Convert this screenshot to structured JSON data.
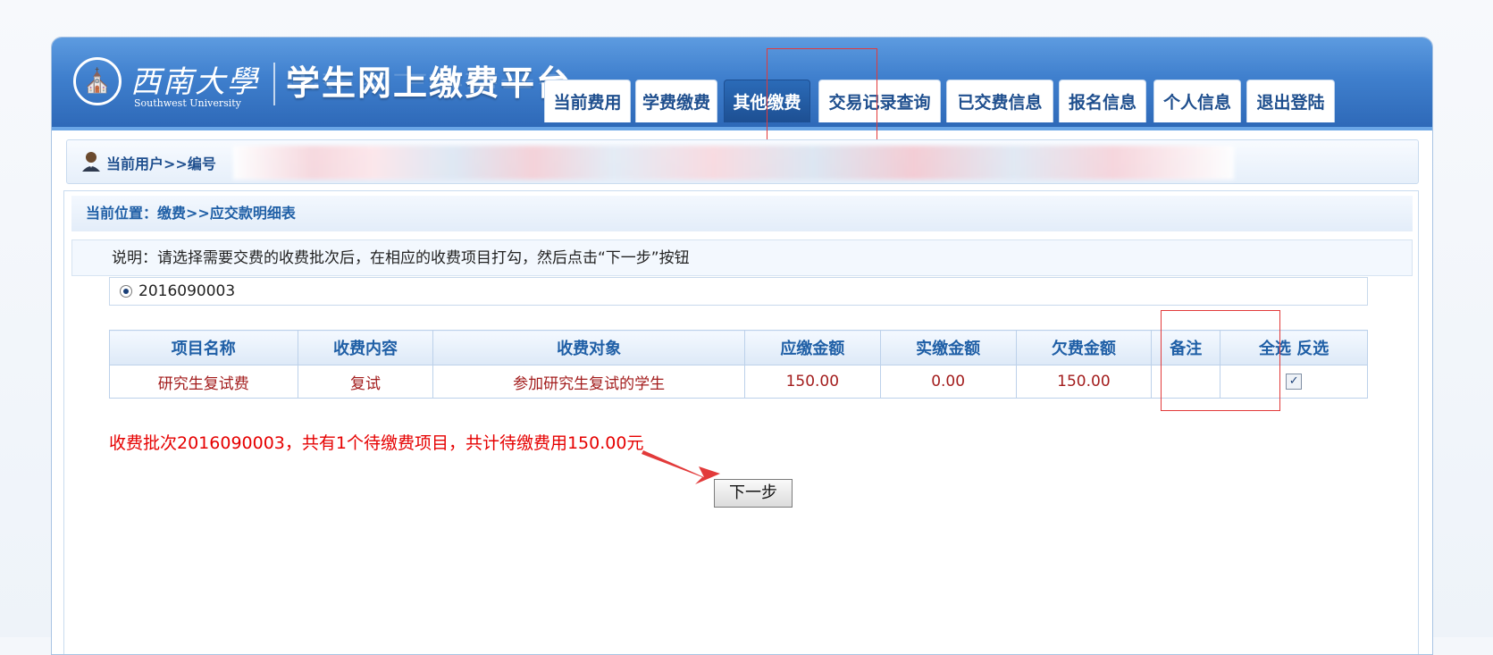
{
  "header": {
    "logo_cn": "西南大學",
    "logo_en": "Southwest University",
    "platform_title": "学生网上缴费平台"
  },
  "nav": {
    "tabs": [
      {
        "label": "当前费用"
      },
      {
        "label": "学费缴费"
      },
      {
        "label": "其他缴费",
        "active": true
      },
      {
        "label": "交易记录查询"
      },
      {
        "label": "已交费信息"
      },
      {
        "label": "报名信息"
      },
      {
        "label": "个人信息"
      },
      {
        "label": "退出登陆"
      }
    ]
  },
  "user": {
    "label": "当前用户>>编号"
  },
  "breadcrumb": {
    "text": "当前位置：缴费>>应交款明细表"
  },
  "notice": {
    "text": "说明：请选择需要交费的收费批次后，在相应的收费项目打勾，然后点击“下一步”按钮"
  },
  "batch": {
    "number": "2016090003",
    "selected": true
  },
  "table": {
    "headers": [
      "项目名称",
      "收费内容",
      "收费对象",
      "应缴金额",
      "实缴金额",
      "欠费金额",
      "备注",
      "全选 反选"
    ],
    "rows": [
      {
        "item": "研究生复试费",
        "content": "复试",
        "target": "参加研究生复试的学生",
        "due": "150.00",
        "paid": "0.00",
        "owed": "150.00",
        "note": "",
        "checked": true
      }
    ]
  },
  "summary": {
    "text": "收费批次2016090003，共有1个待缴费项目，共计待缴费用150.00元"
  },
  "buttons": {
    "next": "下一步"
  },
  "colors": {
    "header_blue": "#3f7fcd",
    "active_tab": "#1d4f92",
    "link_blue": "#1f5fa6",
    "amount_red": "#a31d1d",
    "summary_red": "#e60000",
    "annotation_red": "#e23a3a"
  }
}
